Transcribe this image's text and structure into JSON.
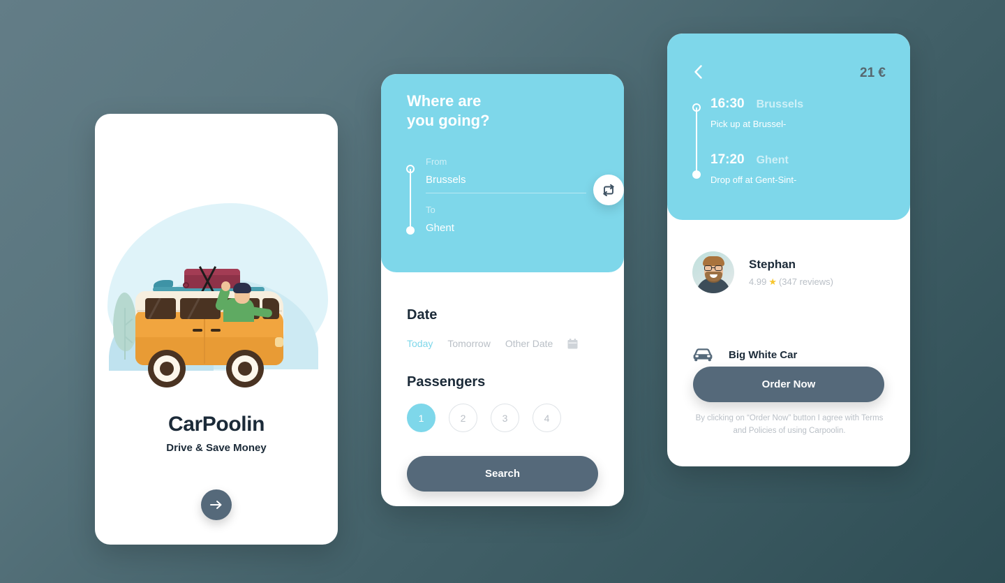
{
  "theme": {
    "accent_cyan": "#7ed7ea",
    "dark_slate": "#55697a",
    "text_dark": "#1b2a38",
    "muted": "#b9bfc6",
    "star_yellow": "#f7c62e",
    "bg_gradient_from": "#637d87",
    "bg_gradient_to": "#2e4d54"
  },
  "onboarding": {
    "title": "CarPoolin",
    "subtitle": "Drive & Save Money",
    "next_icon": "arrow-right-icon",
    "illustration": "van-with-luggage-illustration"
  },
  "search": {
    "heading_line1": "Where are",
    "heading_line2": "you going?",
    "from": {
      "label": "From",
      "value": "Brussels"
    },
    "to": {
      "label": "To",
      "value": "Ghent"
    },
    "swap_icon": "swap-arrows-icon",
    "date": {
      "title": "Date",
      "options": [
        {
          "label": "Today",
          "active": true
        },
        {
          "label": "Tomorrow",
          "active": false
        },
        {
          "label": "Other Date",
          "active": false
        }
      ],
      "calendar_icon": "calendar-icon"
    },
    "passengers": {
      "title": "Passengers",
      "options": [
        "1",
        "2",
        "3",
        "4"
      ],
      "selected": "1"
    },
    "search_label": "Search"
  },
  "trip": {
    "back_icon": "chevron-left-icon",
    "price": "21 €",
    "legs": [
      {
        "time": "16:30",
        "city": "Brussels",
        "desc": "Pick up at Brussel-"
      },
      {
        "time": "17:20",
        "city": "Ghent",
        "desc": "Drop off at Gent-Sint-"
      }
    ],
    "driver": {
      "name": "Stephan",
      "rating": "4.99",
      "star_icon": "star-icon",
      "reviews": "(347 reviews)",
      "avatar": "driver-photo"
    },
    "vehicle": {
      "icon": "car-icon",
      "name": "Big White Car"
    },
    "order_label": "Order Now",
    "disclaimer": "By clicking on “Order Now” button I agree with Terms and Policies of using Carpoolin."
  }
}
